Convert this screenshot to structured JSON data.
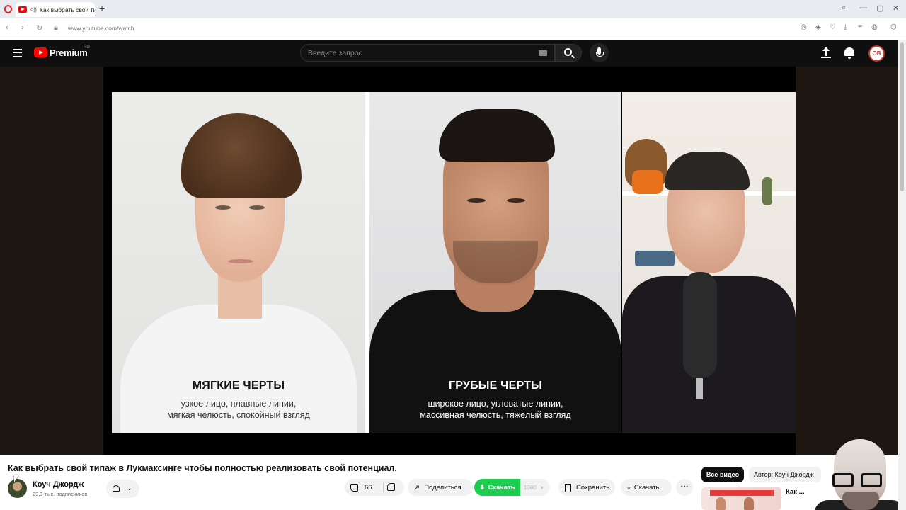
{
  "browser": {
    "tab_title": "Как выбрать свой ти",
    "url": "www.youtube.com/watch"
  },
  "header": {
    "brand": "Premium",
    "region": "RU",
    "search_placeholder": "Введите запрос",
    "avatar_initials": "OB"
  },
  "video_panels": {
    "soft": {
      "title": "МЯГКИЕ ЧЕРТЫ",
      "line1": "узкое лицо, плавные линии,",
      "line2": "мягкая челюсть, спокойный взгляд"
    },
    "rough": {
      "title": "ГРУБЫЕ ЧЕРТЫ",
      "line1": "широкое лицо, угловатые линии,",
      "line2": "массивная челюсть, тяжёлый взгляд"
    }
  },
  "video": {
    "title": "Как выбрать свой типаж в Лукмаксинге чтобы полностью реализовать свой потенциал."
  },
  "channel": {
    "name": "Коуч Джордж",
    "subscribers": "23,3 тыс. подписчиков"
  },
  "actions": {
    "likes": "66",
    "share": "Поделиться",
    "download_green": "Скачать",
    "quality": "1080",
    "save": "Сохранить",
    "download": "Скачать"
  },
  "sidebar": {
    "chip_all": "Все видео",
    "chip_author": "Автор: Коуч Джордж",
    "rec_title": "Как ..."
  },
  "colors": {
    "youtube_red": "#ff0000",
    "download_green": "#1ecc4f",
    "header_bg": "#0f0f0f"
  }
}
